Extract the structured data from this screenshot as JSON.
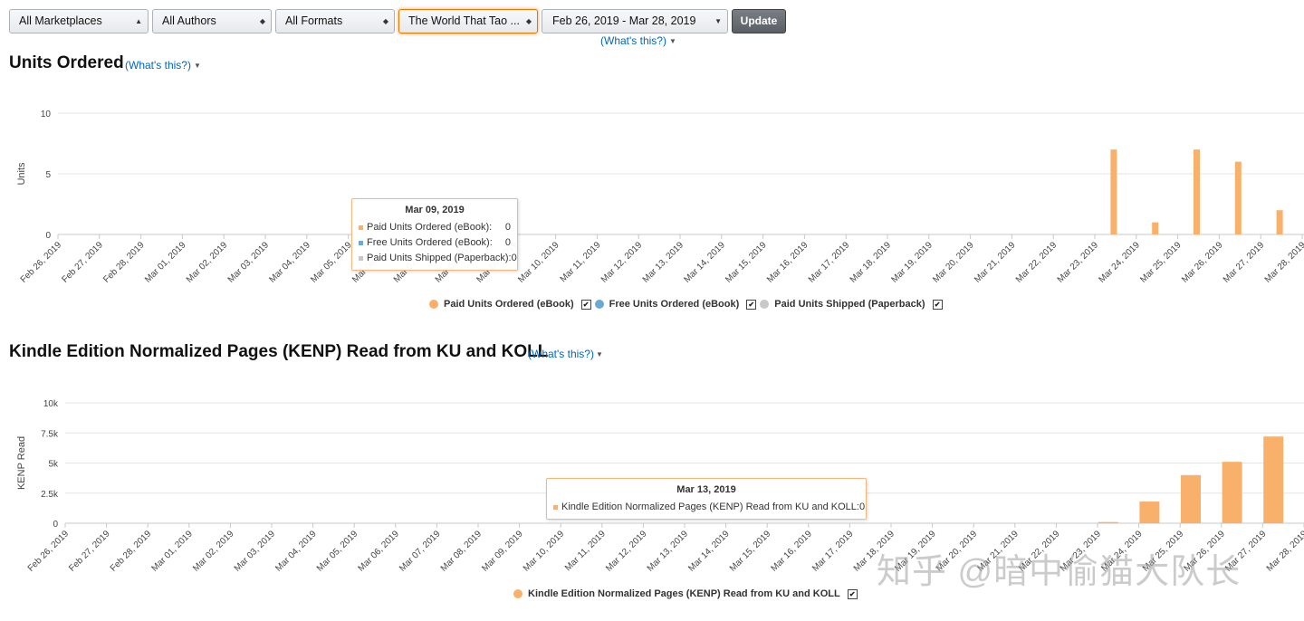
{
  "filters": {
    "marketplaces": "All Marketplaces",
    "authors": "All Authors",
    "formats": "All Formats",
    "title": "The World That Tao ...",
    "date_range": "Feb 26, 2019 - Mar 28, 2019",
    "update_label": "Update",
    "whats_this": "(What's this?)"
  },
  "colors": {
    "orange": "#f9b06b",
    "blue": "#6ea9d6",
    "gray": "#c8c8c8",
    "link": "#0066c0"
  },
  "units_section": {
    "title": "Units Ordered",
    "whats_this": "(What's this?)",
    "legend": [
      {
        "label": "Paid Units Ordered (eBook)",
        "color": "#f9b06b"
      },
      {
        "label": "Free Units Ordered (eBook)",
        "color": "#6ea9d6"
      },
      {
        "label": "Paid Units Shipped (Paperback)",
        "color": "#c8c8c8"
      }
    ],
    "tooltip": {
      "date": "Mar 09, 2019",
      "rows": [
        {
          "label": "Paid Units Ordered (eBook):",
          "value": "0",
          "color": "#f9b06b"
        },
        {
          "label": "Free Units Ordered (eBook):",
          "value": "0",
          "color": "#6ea9d6"
        },
        {
          "label": "Paid Units Shipped (Paperback):",
          "value": "0",
          "color": "#c8c8c8"
        }
      ]
    }
  },
  "kenp_section": {
    "title": "Kindle Edition Normalized Pages (KENP) Read from KU and KOLL",
    "whats_this": "(What's this?)",
    "legend": [
      {
        "label": "Kindle Edition Normalized Pages (KENP) Read from KU and KOLL",
        "color": "#f9b06b"
      }
    ],
    "tooltip": {
      "date": "Mar 13, 2019",
      "rows": [
        {
          "label": "Kindle Edition Normalized Pages (KENP) Read from KU and KOLL:",
          "value": "0",
          "color": "#f9b06b"
        }
      ]
    }
  },
  "watermark": "知乎 @暗中偷猫大队长",
  "chart_data": [
    {
      "type": "bar",
      "ylabel": "Units",
      "ylim": [
        0,
        10
      ],
      "yticks": [
        "0",
        "5",
        "10"
      ],
      "grid": true,
      "categories": [
        "Feb 26, 2019",
        "Feb 27, 2019",
        "Feb 28, 2019",
        "Mar 01, 2019",
        "Mar 02, 2019",
        "Mar 03, 2019",
        "Mar 04, 2019",
        "Mar 05, 2019",
        "Mar 06, 2019",
        "Mar 07, 2019",
        "Mar 08, 2019",
        "Mar 09, 2019",
        "Mar 10, 2019",
        "Mar 11, 2019",
        "Mar 12, 2019",
        "Mar 13, 2019",
        "Mar 14, 2019",
        "Mar 15, 2019",
        "Mar 16, 2019",
        "Mar 17, 2019",
        "Mar 18, 2019",
        "Mar 19, 2019",
        "Mar 20, 2019",
        "Mar 21, 2019",
        "Mar 22, 2019",
        "Mar 23, 2019",
        "Mar 24, 2019",
        "Mar 25, 2019",
        "Mar 26, 2019",
        "Mar 27, 2019",
        "Mar 28, 2019"
      ],
      "series": [
        {
          "name": "Paid Units Ordered (eBook)",
          "color": "#f9b06b",
          "values": [
            0,
            0,
            0,
            0,
            0,
            0,
            0,
            0,
            0,
            0,
            0,
            0,
            0,
            0,
            0,
            0,
            0,
            0,
            0,
            0,
            0,
            0,
            0,
            0,
            0,
            7,
            1,
            7,
            6,
            2,
            0
          ]
        },
        {
          "name": "Free Units Ordered (eBook)",
          "color": "#6ea9d6",
          "values": [
            0,
            0,
            0,
            0,
            0,
            0,
            0,
            0,
            0,
            0,
            0,
            0,
            0,
            0,
            0,
            0,
            0,
            0,
            0,
            0,
            0,
            0,
            0,
            0,
            0,
            0,
            0,
            0,
            0,
            0,
            0
          ]
        },
        {
          "name": "Paid Units Shipped (Paperback)",
          "color": "#c8c8c8",
          "values": [
            0,
            0,
            0,
            0,
            0,
            0,
            0,
            0,
            0,
            0,
            0,
            0,
            0,
            0,
            0,
            0,
            0,
            0,
            0,
            0,
            0,
            0,
            0,
            0,
            0,
            0,
            0,
            0,
            0,
            0,
            0
          ]
        }
      ]
    },
    {
      "type": "bar",
      "ylabel": "KENP Read",
      "ylim": [
        0,
        10000
      ],
      "yticks": [
        "0",
        "2.5k",
        "5k",
        "7.5k",
        "10k"
      ],
      "grid": true,
      "categories": [
        "Feb 26, 2019",
        "Feb 27, 2019",
        "Feb 28, 2019",
        "Mar 01, 2019",
        "Mar 02, 2019",
        "Mar 03, 2019",
        "Mar 04, 2019",
        "Mar 05, 2019",
        "Mar 06, 2019",
        "Mar 07, 2019",
        "Mar 08, 2019",
        "Mar 09, 2019",
        "Mar 10, 2019",
        "Mar 11, 2019",
        "Mar 12, 2019",
        "Mar 13, 2019",
        "Mar 14, 2019",
        "Mar 15, 2019",
        "Mar 16, 2019",
        "Mar 17, 2019",
        "Mar 18, 2019",
        "Mar 19, 2019",
        "Mar 20, 2019",
        "Mar 21, 2019",
        "Mar 22, 2019",
        "Mar 23, 2019",
        "Mar 24, 2019",
        "Mar 25, 2019",
        "Mar 26, 2019",
        "Mar 27, 2019",
        "Mar 28, 2019"
      ],
      "series": [
        {
          "name": "Kindle Edition Normalized Pages (KENP) Read from KU and KOLL",
          "color": "#f9b06b",
          "values": [
            0,
            0,
            0,
            0,
            0,
            0,
            0,
            0,
            0,
            0,
            0,
            0,
            0,
            0,
            0,
            0,
            0,
            0,
            0,
            0,
            0,
            0,
            0,
            0,
            0,
            100,
            1800,
            4000,
            5100,
            7200,
            0
          ]
        }
      ]
    }
  ]
}
